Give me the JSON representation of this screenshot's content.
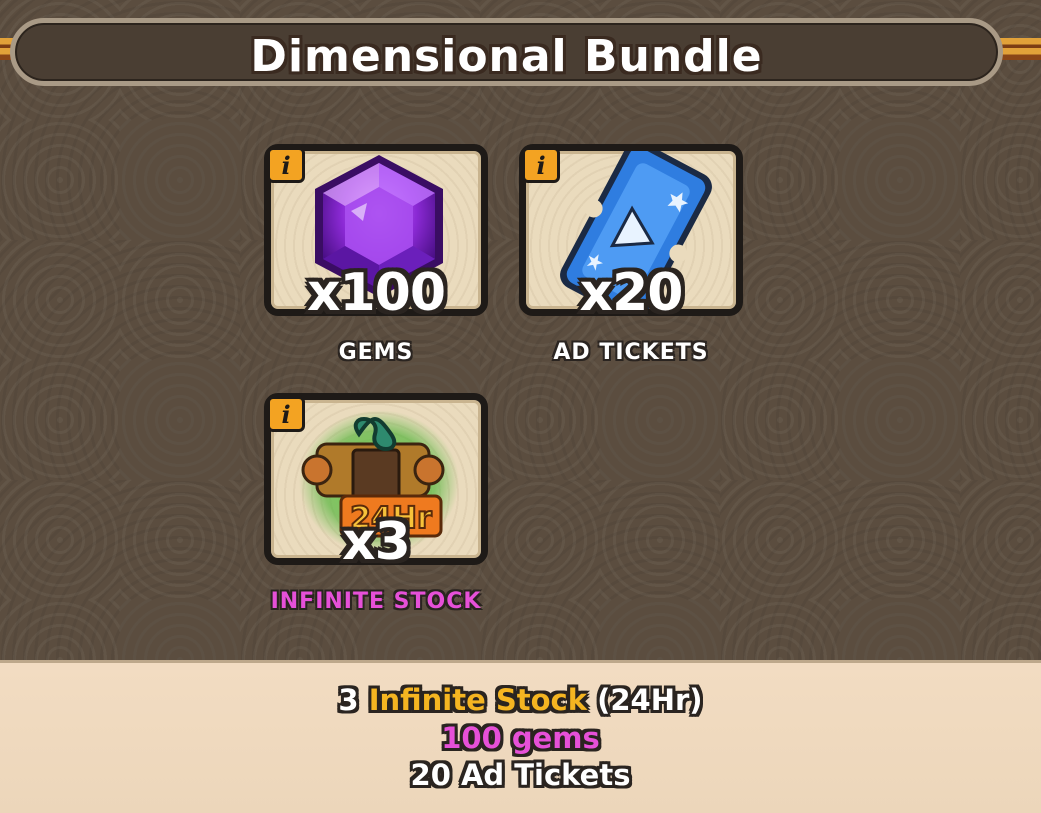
{
  "header": {
    "title": "Dimensional Bundle"
  },
  "items": [
    {
      "info_label": "i",
      "quantity": "x100",
      "name": "GEMS",
      "icon": "purple-gem-icon"
    },
    {
      "info_label": "i",
      "quantity": "x20",
      "name": "AD TICKETS",
      "icon": "blue-ticket-icon"
    },
    {
      "info_label": "i",
      "quantity": "x3",
      "name": "INFINITE STOCK",
      "icon": "infinite-stock-24hr-icon",
      "badge_text": "24Hr"
    }
  ],
  "summary": {
    "line1_count": "3",
    "line1_name": "Infinite Stock",
    "line1_suffix": "(24Hr)",
    "line2": "100 gems",
    "line3": "20 Ad Tickets"
  },
  "colors": {
    "accent_gold": "#f5b521",
    "accent_pink": "#e650d8",
    "info_badge": "#f3a322",
    "card_bg": "#eadbbd"
  }
}
